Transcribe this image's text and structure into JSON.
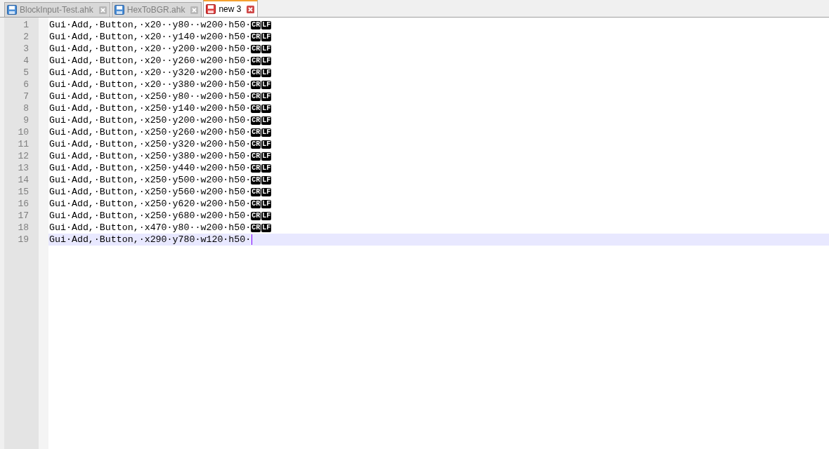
{
  "tabs": [
    {
      "label": "BlockInput-Test.ahk",
      "selected": false,
      "kind": "saved"
    },
    {
      "label": "HexToBGR.ahk",
      "selected": false,
      "kind": "saved"
    },
    {
      "label": "new 3",
      "selected": true,
      "kind": "unsaved"
    }
  ],
  "editor": {
    "lines": [
      {
        "number": "1",
        "text": "Gui·Add,·Button,·x20··y80··w200·h50·",
        "eol": [
          "CR",
          "LF"
        ],
        "current": false
      },
      {
        "number": "2",
        "text": "Gui·Add,·Button,·x20··y140·w200·h50·",
        "eol": [
          "CR",
          "LF"
        ],
        "current": false
      },
      {
        "number": "3",
        "text": "Gui·Add,·Button,·x20··y200·w200·h50·",
        "eol": [
          "CR",
          "LF"
        ],
        "current": false
      },
      {
        "number": "4",
        "text": "Gui·Add,·Button,·x20··y260·w200·h50·",
        "eol": [
          "CR",
          "LF"
        ],
        "current": false
      },
      {
        "number": "5",
        "text": "Gui·Add,·Button,·x20··y320·w200·h50·",
        "eol": [
          "CR",
          "LF"
        ],
        "current": false
      },
      {
        "number": "6",
        "text": "Gui·Add,·Button,·x20··y380·w200·h50·",
        "eol": [
          "CR",
          "LF"
        ],
        "current": false
      },
      {
        "number": "7",
        "text": "Gui·Add,·Button,·x250·y80··w200·h50·",
        "eol": [
          "CR",
          "LF"
        ],
        "current": false
      },
      {
        "number": "8",
        "text": "Gui·Add,·Button,·x250·y140·w200·h50·",
        "eol": [
          "CR",
          "LF"
        ],
        "current": false
      },
      {
        "number": "9",
        "text": "Gui·Add,·Button,·x250·y200·w200·h50·",
        "eol": [
          "CR",
          "LF"
        ],
        "current": false
      },
      {
        "number": "10",
        "text": "Gui·Add,·Button,·x250·y260·w200·h50·",
        "eol": [
          "CR",
          "LF"
        ],
        "current": false
      },
      {
        "number": "11",
        "text": "Gui·Add,·Button,·x250·y320·w200·h50·",
        "eol": [
          "CR",
          "LF"
        ],
        "current": false
      },
      {
        "number": "12",
        "text": "Gui·Add,·Button,·x250·y380·w200·h50·",
        "eol": [
          "CR",
          "LF"
        ],
        "current": false
      },
      {
        "number": "13",
        "text": "Gui·Add,·Button,·x250·y440·w200·h50·",
        "eol": [
          "CR",
          "LF"
        ],
        "current": false
      },
      {
        "number": "14",
        "text": "Gui·Add,·Button,·x250·y500·w200·h50·",
        "eol": [
          "CR",
          "LF"
        ],
        "current": false
      },
      {
        "number": "15",
        "text": "Gui·Add,·Button,·x250·y560·w200·h50·",
        "eol": [
          "CR",
          "LF"
        ],
        "current": false
      },
      {
        "number": "16",
        "text": "Gui·Add,·Button,·x250·y620·w200·h50·",
        "eol": [
          "CR",
          "LF"
        ],
        "current": false
      },
      {
        "number": "17",
        "text": "Gui·Add,·Button,·x250·y680·w200·h50·",
        "eol": [
          "CR",
          "LF"
        ],
        "current": false
      },
      {
        "number": "18",
        "text": "Gui·Add,·Button,·x470·y80··w200·h50·",
        "eol": [
          "CR",
          "LF"
        ],
        "current": false
      },
      {
        "number": "19",
        "text": "Gui·Add,·Button,·x290·y780·w120·h50·",
        "current": true
      }
    ]
  }
}
